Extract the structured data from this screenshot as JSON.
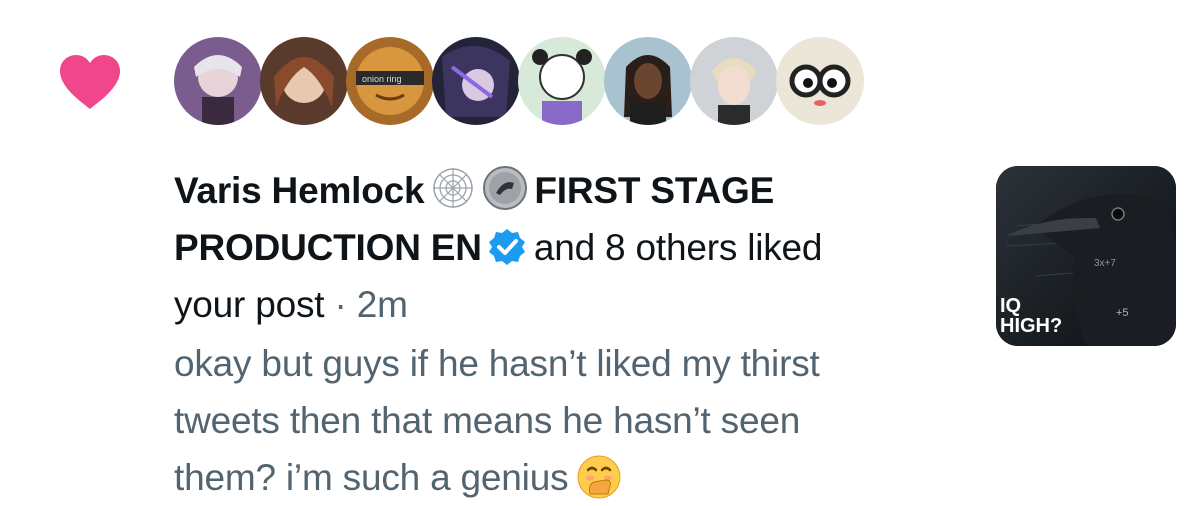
{
  "notification": {
    "type": "like",
    "icon": "heart-icon",
    "accent_color": "#f0468c",
    "avatars": [
      {
        "name": "avatar-1",
        "bg": "#7b5c8f"
      },
      {
        "name": "avatar-2",
        "bg": "#8a5a3c"
      },
      {
        "name": "avatar-3",
        "bg": "#c8863a",
        "caption": "onion ring"
      },
      {
        "name": "avatar-4",
        "bg": "#2a2b44"
      },
      {
        "name": "avatar-5",
        "bg": "#cfe6d2"
      },
      {
        "name": "avatar-6",
        "bg": "#9fb8c8"
      },
      {
        "name": "avatar-7",
        "bg": "#c9cdd2"
      },
      {
        "name": "avatar-8",
        "bg": "#e9e3d6"
      }
    ],
    "user1_name": "Varis Hemlock",
    "user2_name_part1": "FIRST STAGE",
    "user2_name_part2": "PRODUCTION EN",
    "liked_text": "and 8 others liked",
    "liked_text_end": "your post",
    "time": "· 2m",
    "post_line1": "okay but guys if he hasn’t liked my thirst",
    "post_line2": "tweets then that means he hasn’t seen",
    "post_line3": "them? i’m such a genius",
    "emoji": "hand-over-mouth-emoji",
    "verified_color": "#1d9bf0",
    "thumbnail": {
      "text_line1": "IQ",
      "text_line2": "HIGH?"
    }
  }
}
